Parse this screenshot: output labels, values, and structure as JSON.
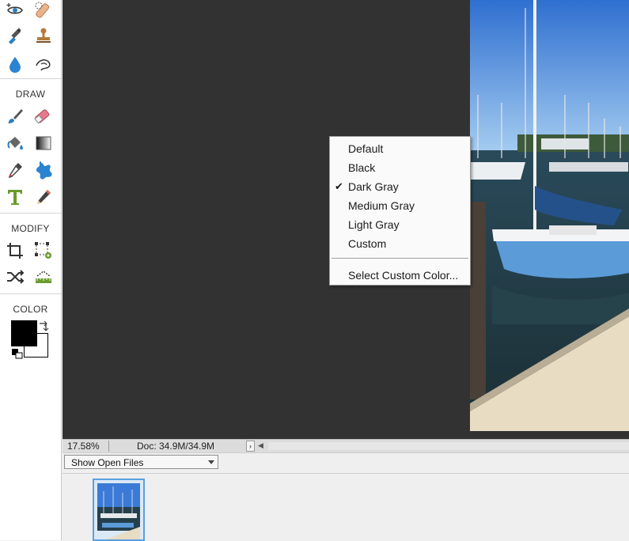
{
  "toolbox": {
    "sections": {
      "draw": "DRAW",
      "modify": "MODIFY",
      "color": "COLOR"
    },
    "tools": [
      {
        "name": "red-eye-icon"
      },
      {
        "name": "spot-healing-icon"
      },
      {
        "name": "smart-brush-icon"
      },
      {
        "name": "clone-stamp-icon"
      },
      {
        "name": "blur-icon"
      },
      {
        "name": "smudge-icon"
      },
      {
        "name": "brush-icon"
      },
      {
        "name": "eraser-icon"
      },
      {
        "name": "paint-bucket-icon"
      },
      {
        "name": "gradient-icon"
      },
      {
        "name": "eyedropper-icon"
      },
      {
        "name": "custom-shape-icon"
      },
      {
        "name": "type-icon"
      },
      {
        "name": "pencil-icon"
      },
      {
        "name": "crop-icon"
      },
      {
        "name": "recompose-icon"
      },
      {
        "name": "content-aware-move-icon"
      },
      {
        "name": "straighten-icon"
      }
    ],
    "colors": {
      "foreground": "#000000",
      "background": "#ffffff"
    }
  },
  "status_bar": {
    "zoom": "17.58%",
    "doc_size": "Doc: 34.9M/34.9M",
    "arrow": "›"
  },
  "bin": {
    "show_select": "Show Open Files"
  },
  "context_menu": {
    "items": [
      {
        "label": "Default",
        "checked": false
      },
      {
        "label": "Black",
        "checked": false
      },
      {
        "label": "Dark Gray",
        "checked": true
      },
      {
        "label": "Medium Gray",
        "checked": false
      },
      {
        "label": "Light Gray",
        "checked": false
      },
      {
        "label": "Custom",
        "checked": false
      }
    ],
    "check_mark": "✔",
    "select_custom": "Select Custom Color..."
  },
  "canvas": {
    "background": "#323232"
  }
}
